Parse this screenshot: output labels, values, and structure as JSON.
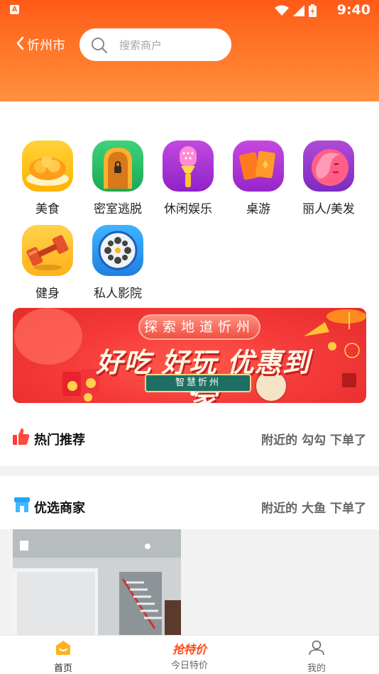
{
  "status_bar": {
    "time": "9:40"
  },
  "header": {
    "city": "忻州市",
    "search_placeholder": "搜索商户"
  },
  "categories": [
    {
      "label": "美食",
      "icon": "food-icon"
    },
    {
      "label": "密室逃脱",
      "icon": "escape-room-door-icon"
    },
    {
      "label": "休闲娱乐",
      "icon": "microphone-icon"
    },
    {
      "label": "桌游",
      "icon": "cards-icon"
    },
    {
      "label": "丽人/美发",
      "icon": "beauty-icon"
    },
    {
      "label": "健身",
      "icon": "dumbbell-icon"
    },
    {
      "label": "私人影院",
      "icon": "film-reel-icon"
    }
  ],
  "banner": {
    "pill_text": "探索地道忻州",
    "headline": "好吃 好玩 优惠到家",
    "ribbon_text": "智慧忻州"
  },
  "hot": {
    "title": "热门推荐",
    "activity": "附近的 勾勾 下单了"
  },
  "featured": {
    "title": "优选商家",
    "activity": "附近的 大鱼 下单了"
  },
  "tabbar": {
    "home": "首页",
    "deals_logo": "抢特价",
    "deals": "今日特价",
    "mine": "我的"
  },
  "colors": {
    "brand": "#ff6a1e",
    "banner": "#f53a3a"
  }
}
